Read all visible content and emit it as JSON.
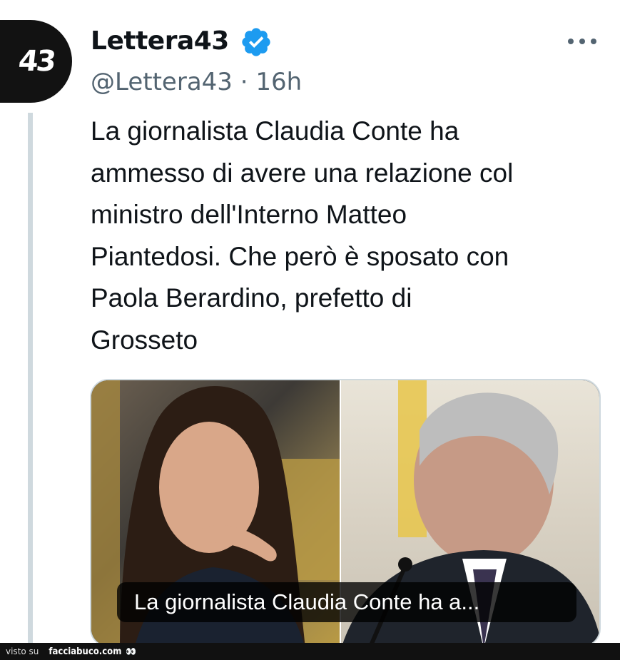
{
  "author": {
    "avatar_text": "43",
    "name": "Lettera43",
    "verified_icon": "verified-badge-icon",
    "handle": "@Lettera43",
    "separator": "·",
    "time": "16h"
  },
  "menu": {
    "icon": "more-horizontal-icon"
  },
  "tweet": {
    "lines": [
      "La giornalista Claudia Conte ha",
      "ammesso di avere una relazione col",
      "ministro dell'Interno Matteo",
      "Piantedosi. Che però è sposato con",
      "Paola Berardino, prefetto di",
      "Grosseto"
    ]
  },
  "media": {
    "caption": "La giornalista Claudia Conte ha a..."
  },
  "watermark": {
    "seen_on": "visto su",
    "site": "facciabuco.com",
    "eyes": "👀"
  },
  "colors": {
    "verified": "#1d9bf0",
    "secondary_text": "#536471",
    "thread_line": "#cfd9de"
  }
}
